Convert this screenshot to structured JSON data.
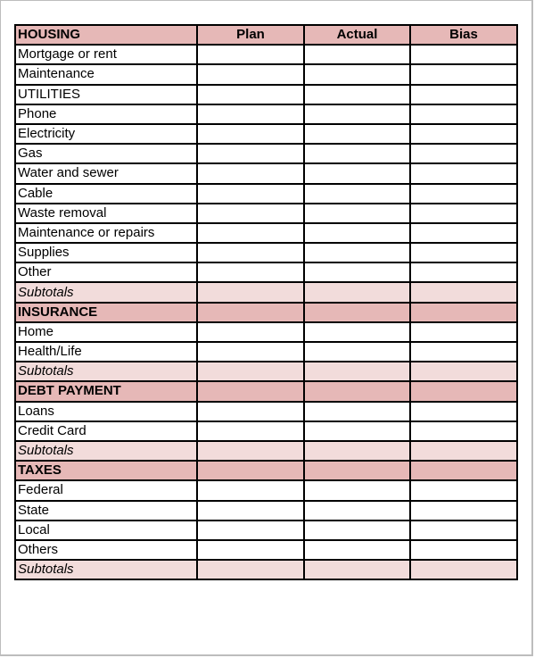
{
  "columns": {
    "plan": "Plan",
    "actual": "Actual",
    "bias": "Bias"
  },
  "colors": {
    "section_header_bg": "#e6b8b7",
    "subtotal_bg": "#f2dcdb",
    "border": "#000000"
  },
  "rows": [
    {
      "type": "section",
      "label": "HOUSING",
      "show_headers": true
    },
    {
      "type": "item",
      "label": "Mortgage or rent"
    },
    {
      "type": "item",
      "label": "Maintenance"
    },
    {
      "type": "item",
      "label": "UTILITIES"
    },
    {
      "type": "item",
      "label": "Phone"
    },
    {
      "type": "item",
      "label": "Electricity"
    },
    {
      "type": "item",
      "label": "Gas"
    },
    {
      "type": "item",
      "label": "Water and sewer"
    },
    {
      "type": "item",
      "label": "Cable"
    },
    {
      "type": "item",
      "label": "Waste removal"
    },
    {
      "type": "item",
      "label": "Maintenance or repairs"
    },
    {
      "type": "item",
      "label": "Supplies"
    },
    {
      "type": "item",
      "label": "Other"
    },
    {
      "type": "subtotal",
      "label": "Subtotals"
    },
    {
      "type": "section",
      "label": "INSURANCE"
    },
    {
      "type": "item",
      "label": "Home"
    },
    {
      "type": "item",
      "label": "Health/Life"
    },
    {
      "type": "subtotal",
      "label": "Subtotals"
    },
    {
      "type": "section",
      "label": "DEBT PAYMENT"
    },
    {
      "type": "item",
      "label": "Loans"
    },
    {
      "type": "item",
      "label": "Credit Card"
    },
    {
      "type": "subtotal",
      "label": "Subtotals"
    },
    {
      "type": "section",
      "label": "TAXES"
    },
    {
      "type": "item",
      "label": "Federal"
    },
    {
      "type": "item",
      "label": "State"
    },
    {
      "type": "item",
      "label": "Local"
    },
    {
      "type": "item",
      "label": "Others"
    },
    {
      "type": "subtotal",
      "label": "Subtotals"
    }
  ]
}
